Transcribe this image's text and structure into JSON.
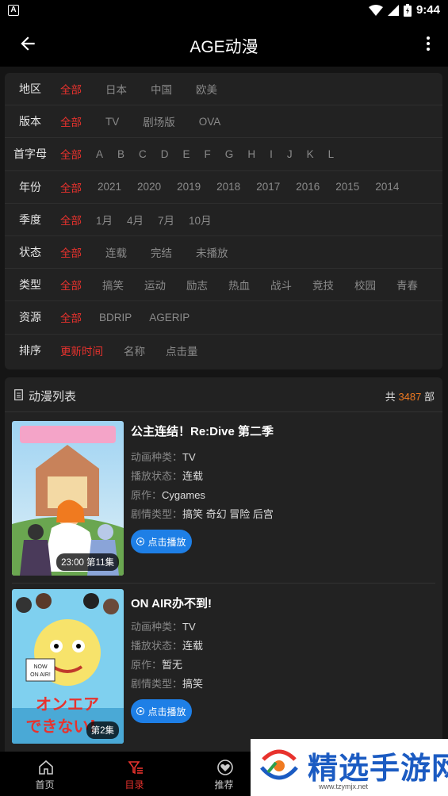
{
  "status": {
    "time": "9:44"
  },
  "appbar": {
    "title": "AGE动漫"
  },
  "filters": [
    {
      "label": "地区",
      "options": [
        "全部",
        "日本",
        "中国",
        "欧美"
      ]
    },
    {
      "label": "版本",
      "options": [
        "全部",
        "TV",
        "剧场版",
        "OVA"
      ]
    },
    {
      "label": "首字母",
      "options": [
        "全部",
        "A",
        "B",
        "C",
        "D",
        "E",
        "F",
        "G",
        "H",
        "I",
        "J",
        "K",
        "L"
      ]
    },
    {
      "label": "年份",
      "options": [
        "全部",
        "2021",
        "2020",
        "2019",
        "2018",
        "2017",
        "2016",
        "2015",
        "2014"
      ]
    },
    {
      "label": "季度",
      "options": [
        "全部",
        "1月",
        "4月",
        "7月",
        "10月"
      ]
    },
    {
      "label": "状态",
      "options": [
        "全部",
        "连载",
        "完结",
        "未播放"
      ]
    },
    {
      "label": "类型",
      "options": [
        "全部",
        "搞笑",
        "运动",
        "励志",
        "热血",
        "战斗",
        "竞技",
        "校园",
        "青春"
      ]
    },
    {
      "label": "资源",
      "options": [
        "全部",
        "BDRIP",
        "AGERIP"
      ]
    },
    {
      "label": "排序",
      "options": [
        "更新时间",
        "名称",
        "点击量"
      ]
    }
  ],
  "list": {
    "title": "动漫列表",
    "count_prefix": "共",
    "count": "3487",
    "count_suffix": "部",
    "items": [
      {
        "title": "公主连结！Re:Dive 第二季",
        "type_label": "动画种类：",
        "type": "TV",
        "status_label": "播放状态：",
        "status": "连载",
        "origin_label": "原作：",
        "origin": "Cygames",
        "genre_label": "剧情类型：",
        "genre": "搞笑 奇幻 冒险 后宫",
        "badge": "23:00 第11集",
        "play": "点击播放"
      },
      {
        "title": "ON AIR办不到!",
        "type_label": "动画种类：",
        "type": "TV",
        "status_label": "播放状态：",
        "status": "连载",
        "origin_label": "原作：",
        "origin": "暂无",
        "genre_label": "剧情类型：",
        "genre": "搞笑",
        "badge": "第2集",
        "play": "点击播放"
      }
    ]
  },
  "nav": [
    {
      "label": "首页",
      "icon": "home-icon"
    },
    {
      "label": "目录",
      "icon": "filter-list-icon"
    },
    {
      "label": "推荐",
      "icon": "heart-icon"
    }
  ],
  "watermark": {
    "text": "精选手游网",
    "url": "www.tzymjx.net"
  },
  "colors": {
    "accent": "#e8322d",
    "play": "#1e7fe6",
    "count": "#f07a21"
  }
}
